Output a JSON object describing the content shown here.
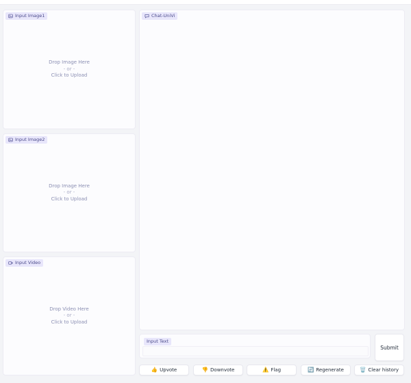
{
  "panels": {
    "image1": {
      "label": "Input Image1",
      "drop_text": "Drop Image Here",
      "or_text": "- or -",
      "upload_text": "Click to Upload"
    },
    "image2": {
      "label": "Input Image2",
      "drop_text": "Drop Image Here",
      "or_text": "- or -",
      "upload_text": "Click to Upload"
    },
    "video": {
      "label": "Input Video",
      "drop_text": "Drop Video Here",
      "or_text": "- or -",
      "upload_text": "Click to Upload"
    },
    "chat": {
      "label": "Chat-UniVi"
    }
  },
  "input_text": {
    "label": "Input Text",
    "value": "",
    "placeholder": ""
  },
  "submit_label": "Submit",
  "buttons": {
    "upvote": {
      "label": "Upvote",
      "icon": "👍"
    },
    "downvote": {
      "label": "Downvote",
      "icon": "👎"
    },
    "flag": {
      "label": "Flag",
      "icon": "⚠️"
    },
    "regenerate": {
      "label": "Regenerate",
      "icon": "🔄"
    },
    "clear": {
      "label": "Clear history",
      "icon": "🗑️"
    }
  },
  "colors": {
    "accent_tag_bg": "#e8e6fb",
    "panel_bg": "#fcfcfe",
    "page_bg": "#f3f4f7"
  }
}
